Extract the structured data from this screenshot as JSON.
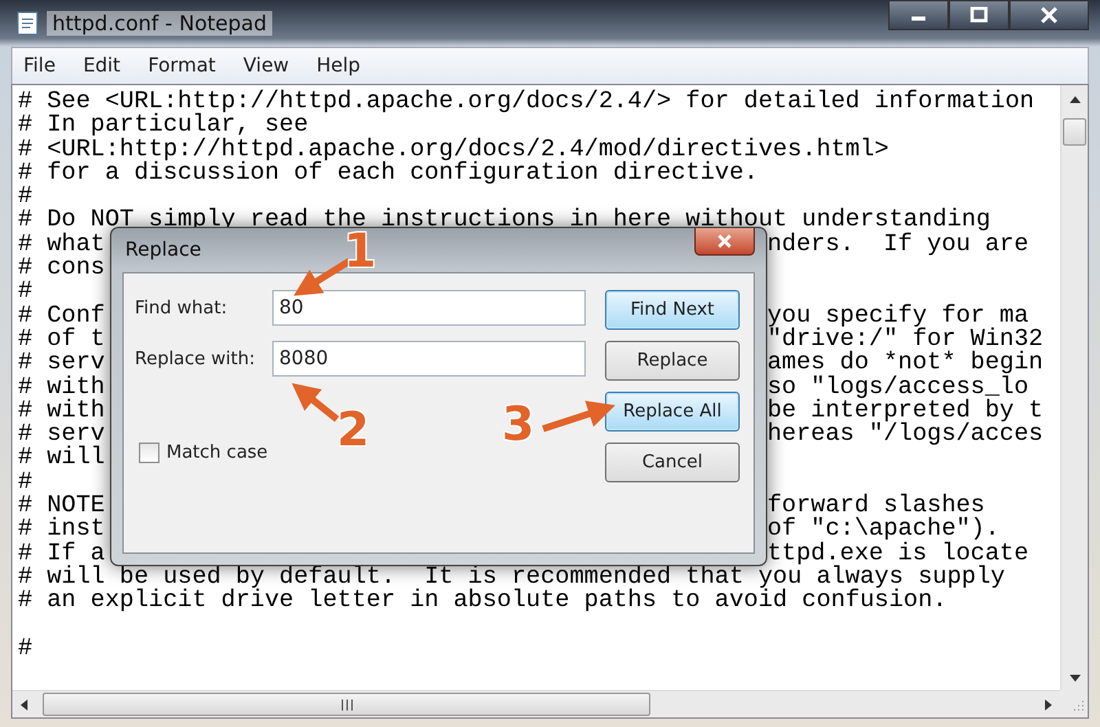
{
  "window": {
    "title": "httpd.conf - Notepad"
  },
  "menu": [
    "File",
    "Edit",
    "Format",
    "View",
    "Help"
  ],
  "editor": {
    "lines": [
      {
        "left": "# See <URL:http://httpd.apache.org/docs/2.4/> for detailed information"
      },
      {
        "left": "# In particular, see"
      },
      {
        "left": "# <URL:http://httpd.apache.org/docs/2.4/mod/directives.html>"
      },
      {
        "left": "# for a discussion of each configuration directive."
      },
      {
        "left": "#"
      },
      {
        "left": "# Do NOT simply read the instructions in here without understanding"
      },
      {
        "left": "# what",
        "right": "nders.  If you are"
      },
      {
        "left": "# cons"
      },
      {
        "left": "#"
      },
      {
        "left": "# Conf",
        "right": "you specify for ma"
      },
      {
        "left": "# of t",
        "right": "\"drive:/\" for Win32"
      },
      {
        "left": "# serv",
        "right": "ames do *not* begin"
      },
      {
        "left": "# with",
        "right": "so \"logs/access_lo"
      },
      {
        "left": "# with",
        "right": "be interpreted by t"
      },
      {
        "left": "# serv",
        "right": "hereas \"/logs/acces"
      },
      {
        "left": "# will"
      },
      {
        "left": "#"
      },
      {
        "left": "# NOTE",
        "right": "forward slashes"
      },
      {
        "left": "# inst",
        "right": "of \"c:\\apache\")."
      },
      {
        "left": "# If a",
        "right": "ttpd.exe is locate"
      },
      {
        "left": "# will be used by default.  It is recommended that you always supply"
      },
      {
        "left": "# an explicit drive letter in absolute paths to avoid confusion."
      },
      {
        "left": "#",
        "blank_before": true
      }
    ]
  },
  "dialog": {
    "title": "Replace",
    "fields": [
      {
        "label": "Find what:",
        "value": "80"
      },
      {
        "label": "Replace with:",
        "value": "8080"
      }
    ],
    "buttons": [
      {
        "label": "Find Next",
        "highlighted": true
      },
      {
        "label": "Replace",
        "highlighted": false
      },
      {
        "label": "Replace All",
        "highlighted": true
      },
      {
        "label": "Cancel",
        "highlighted": false
      }
    ],
    "match_case": {
      "label": "Match case",
      "checked": false
    }
  },
  "annotations": [
    {
      "label": "1"
    },
    {
      "label": "2"
    },
    {
      "label": "3"
    }
  ]
}
